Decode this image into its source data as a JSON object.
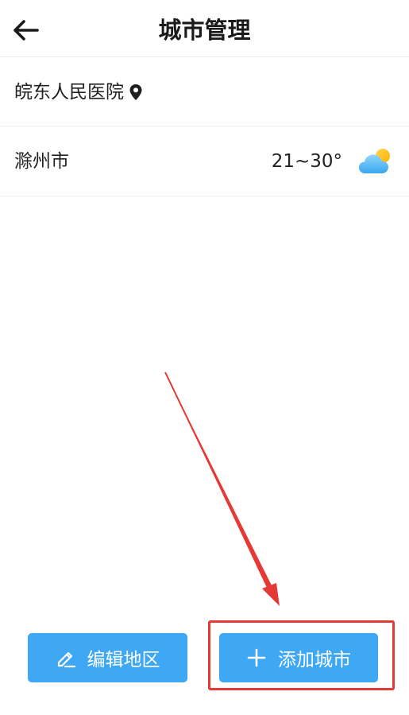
{
  "header": {
    "title": "城市管理",
    "back_icon": "arrow-left-icon"
  },
  "location_row": {
    "label": "皖东人民医院",
    "icon": "map-pin-icon"
  },
  "city_row": {
    "name": "滁州市",
    "temperature": "21~30°",
    "weather_icon": "partly-cloudy-icon"
  },
  "buttons": {
    "edit_label": "编辑地区",
    "add_label": "添加城市"
  },
  "colors": {
    "accent": "#3ea8f5",
    "annotation": "#e53935",
    "text": "#222222"
  }
}
